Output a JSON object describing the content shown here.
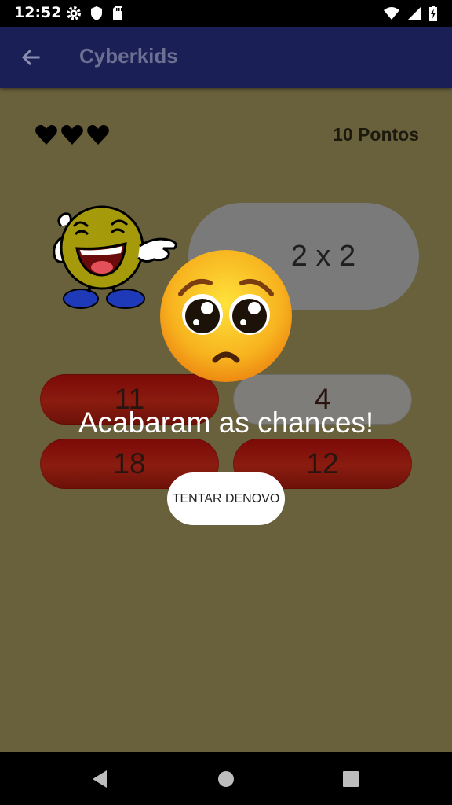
{
  "status_bar": {
    "time": "12:52",
    "icons_left": [
      "gear-icon",
      "shield-icon",
      "sd-card-icon"
    ],
    "icons_right": [
      "wifi-icon",
      "signal-icon",
      "battery-charging-icon"
    ]
  },
  "app_bar": {
    "title": "Cyberkids",
    "back_icon": "arrow-left-icon",
    "background": "#1a1f55",
    "title_color": "#6b6f92"
  },
  "game": {
    "lives": 3,
    "score_label": "10 Pontos",
    "question": "2 x 2",
    "answers": [
      {
        "label": "11",
        "state": "wrong"
      },
      {
        "label": "4",
        "state": "neutral"
      },
      {
        "label": "18",
        "state": "wrong"
      },
      {
        "label": "12",
        "state": "wrong"
      }
    ],
    "background": "#69603c"
  },
  "game_over": {
    "emoji": "pleading-face-emoji",
    "message": "Acabaram as chances!",
    "retry_label": "TENTAR DENOVO"
  },
  "nav_bar": {
    "buttons": [
      "back-triangle-icon",
      "home-circle-icon",
      "recents-square-icon"
    ]
  }
}
